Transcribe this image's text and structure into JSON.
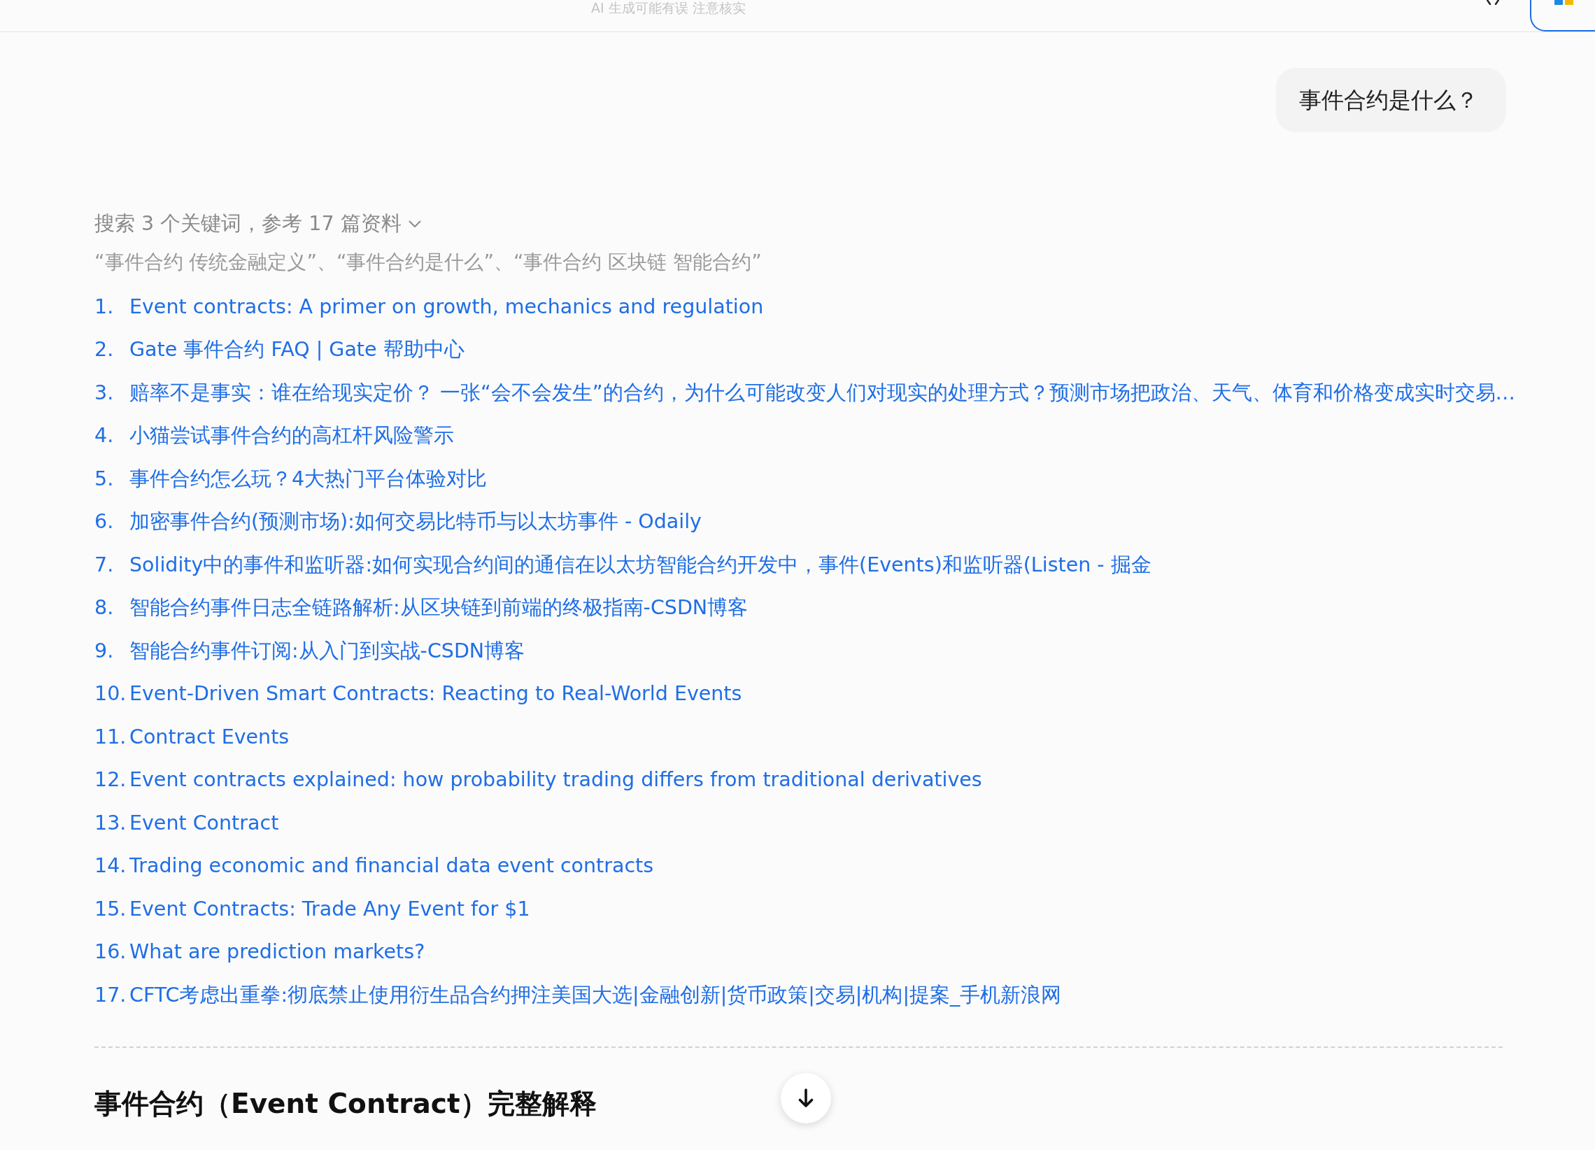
{
  "top_bar": {
    "notice": "AI 生成可能有误 注意核实"
  },
  "user_message": {
    "text": "事件合约是什么？"
  },
  "search": {
    "summary": "搜索 3 个关键词，参考 17 篇资料",
    "keywords": "“事件合约 传统金融定义”、“事件合约是什么”、“事件合约 区块链 智能合约”"
  },
  "sources": [
    {
      "number": "1.",
      "title": "Event contracts: A primer on growth, mechanics and regulation"
    },
    {
      "number": "2.",
      "title": "Gate 事件合约 FAQ | Gate 帮助中心"
    },
    {
      "number": "3.",
      "title": "赔率不是事实：谁在给现实定价？ 一张“会不会发生”的合约，为什么可能改变人们对现实的处理方式？预测市场把政治、天气、体育和价格变成实时交易…"
    },
    {
      "number": "4.",
      "title": "小猫尝试事件合约的高杠杆风险警示"
    },
    {
      "number": "5.",
      "title": "事件合约怎么玩？4大热门平台体验对比"
    },
    {
      "number": "6.",
      "title": "加密事件合约(预测市场):如何交易比特币与以太坊事件 - Odaily"
    },
    {
      "number": "7.",
      "title": "Solidity中的事件和监听器:如何实现合约间的通信在以太坊智能合约开发中，事件(Events)和监听器(Listen - 掘金"
    },
    {
      "number": "8.",
      "title": "智能合约事件日志全链路解析:从区块链到前端的终极指南-CSDN博客"
    },
    {
      "number": "9.",
      "title": "智能合约事件订阅:从入门到实战-CSDN博客"
    },
    {
      "number": "10.",
      "title": "Event-Driven Smart Contracts: Reacting to Real-World Events"
    },
    {
      "number": "11.",
      "title": "Contract Events"
    },
    {
      "number": "12.",
      "title": "Event contracts explained: how probability trading differs from traditional derivatives"
    },
    {
      "number": "13.",
      "title": "Event Contract"
    },
    {
      "number": "14.",
      "title": "Trading economic and financial data event contracts"
    },
    {
      "number": "15.",
      "title": "Event Contracts: Trade Any Event for $1"
    },
    {
      "number": "16.",
      "title": "What are prediction markets?"
    },
    {
      "number": "17.",
      "title": "CFTC考虑出重拳:彻底禁止使用衍生品合约押注美国大选|金融创新|货币政策|交易|机构|提案_手机新浪网"
    }
  ],
  "answer": {
    "heading": "事件合约（Event Contract）完整解释"
  }
}
